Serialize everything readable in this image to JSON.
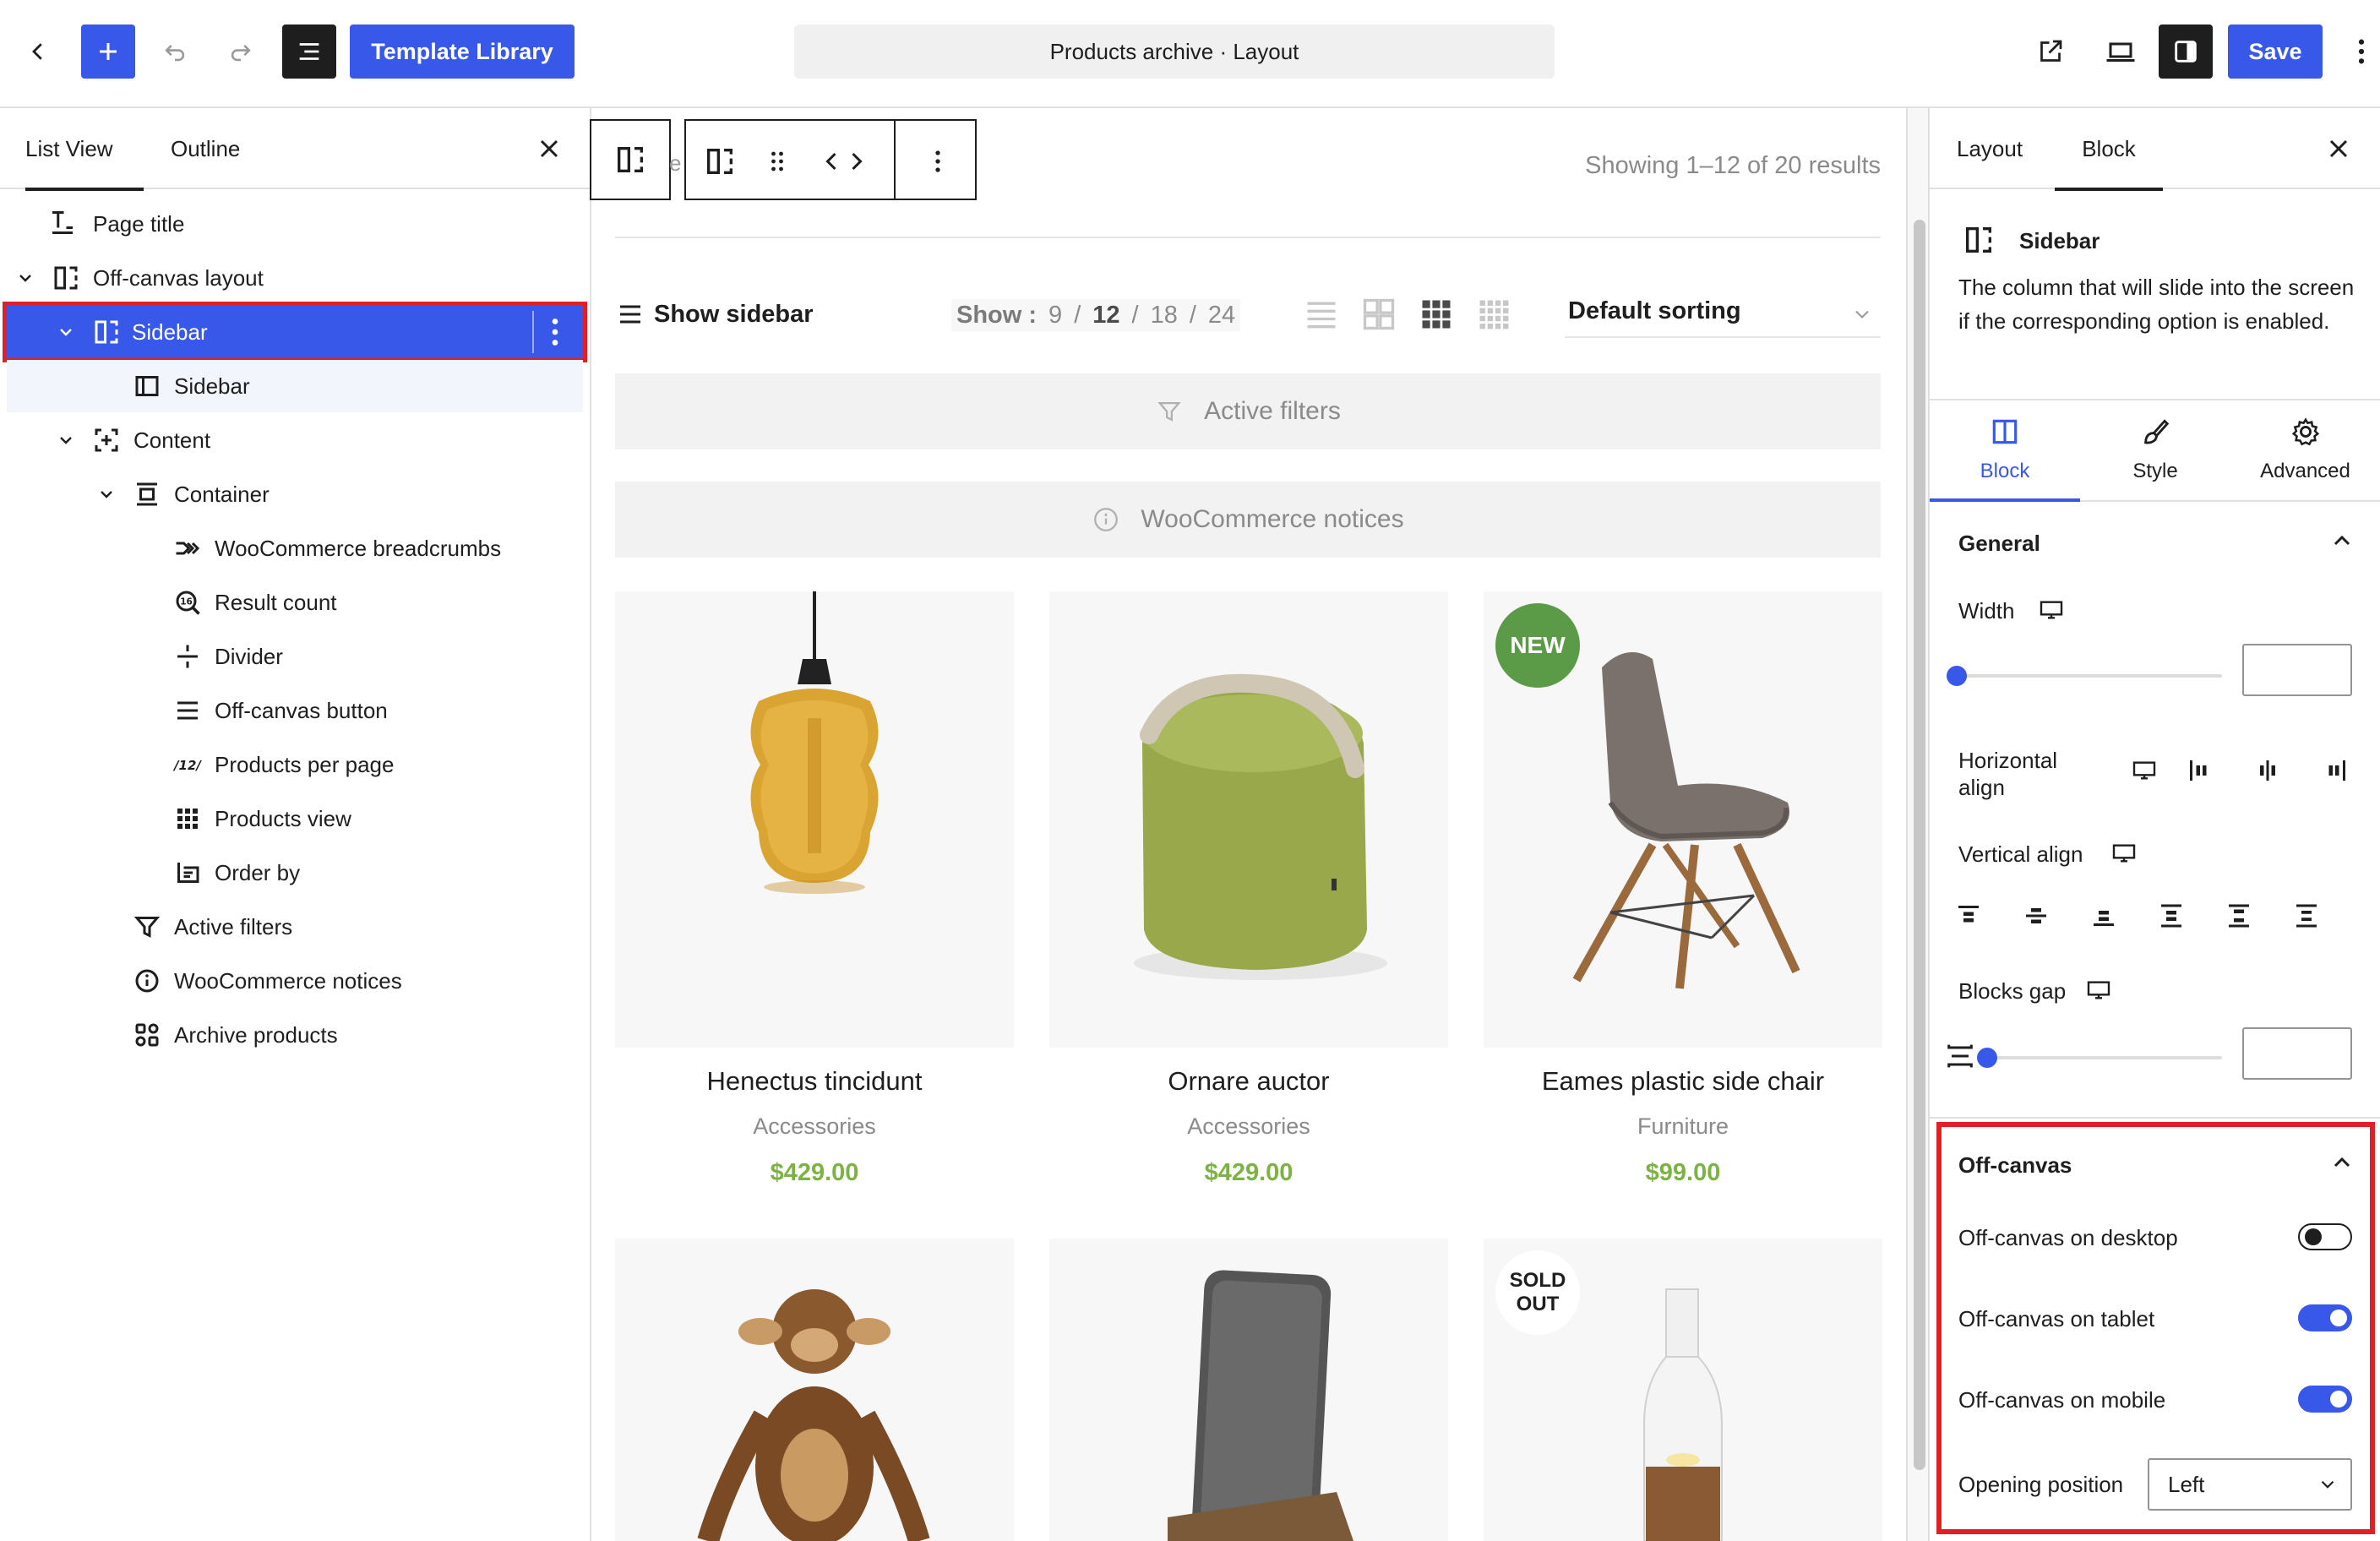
{
  "topbar": {
    "template_library_label": "Template Library",
    "document_title": "Products archive · Layout",
    "save_label": "Save"
  },
  "left_panel": {
    "tabs": [
      {
        "label": "List View",
        "active": true
      },
      {
        "label": "Outline",
        "active": false
      }
    ],
    "tree": [
      {
        "label": "Page title",
        "icon": "page-title-icon"
      },
      {
        "label": "Off-canvas layout",
        "icon": "off-canvas-layout-icon"
      },
      {
        "label": "Sidebar",
        "icon": "sidebar-column-icon",
        "selected": true
      },
      {
        "label": "Sidebar",
        "icon": "sidebar-panel-icon"
      },
      {
        "label": "Content",
        "icon": "content-icon"
      },
      {
        "label": "Container",
        "icon": "container-icon"
      },
      {
        "label": "WooCommerce breadcrumbs",
        "icon": "breadcrumbs-icon"
      },
      {
        "label": "Result count",
        "icon": "result-count-icon"
      },
      {
        "label": "Divider",
        "icon": "divider-icon"
      },
      {
        "label": "Off-canvas button",
        "icon": "menu-icon"
      },
      {
        "label": "Products per page",
        "icon": "products-per-page-icon"
      },
      {
        "label": "Products view",
        "icon": "grid-icon"
      },
      {
        "label": "Order by",
        "icon": "order-by-icon"
      },
      {
        "label": "Active filters",
        "icon": "filter-icon"
      },
      {
        "label": "WooCommerce notices",
        "icon": "info-icon"
      },
      {
        "label": "Archive products",
        "icon": "archive-products-icon"
      }
    ]
  },
  "canvas": {
    "toolbar_partial_text": "e",
    "result_count": "Showing 1–12 of 20 results",
    "show_sidebar_label": "Show sidebar",
    "per_page": {
      "label": "Show :",
      "options": [
        "9",
        "12",
        "18",
        "24"
      ],
      "separator": "/",
      "selected": "12"
    },
    "sorting": "Default sorting",
    "active_filters": "Active filters",
    "woocommerce_notices": "WooCommerce notices",
    "products": [
      {
        "title": "Henectus tincidunt",
        "category": "Accessories",
        "price": "$429.00"
      },
      {
        "title": "Ornare auctor",
        "category": "Accessories",
        "price": "$429.00"
      },
      {
        "title": "Eames plastic side chair",
        "category": "Furniture",
        "price": "$99.00",
        "badge": "NEW"
      }
    ],
    "row2_badge": {
      "line1": "SOLD",
      "line2": "OUT"
    },
    "colors": {
      "accent": "#3858e9",
      "price": "#7cb342",
      "new_badge": "#5b9a46",
      "highlight": "#e11f26"
    }
  },
  "right_panel": {
    "tabs": [
      {
        "label": "Layout",
        "active": false
      },
      {
        "label": "Block",
        "active": true
      }
    ],
    "block_name": "Sidebar",
    "block_description": "The column that will slide into the screen if the corresponding option is enabled.",
    "sub_tabs": [
      {
        "label": "Block",
        "active": true
      },
      {
        "label": "Style",
        "active": false
      },
      {
        "label": "Advanced",
        "active": false
      }
    ],
    "general": {
      "title": "General",
      "width_label": "Width",
      "width_value": "",
      "horizontal_align_label": "Horizontal align",
      "vertical_align_label": "Vertical align",
      "blocks_gap_label": "Blocks gap",
      "blocks_gap_value": ""
    },
    "offcanvas": {
      "title": "Off-canvas",
      "desktop_label": "Off-canvas on desktop",
      "desktop_on": false,
      "tablet_label": "Off-canvas on tablet",
      "tablet_on": true,
      "mobile_label": "Off-canvas on mobile",
      "mobile_on": true,
      "opening_position_label": "Opening position",
      "opening_position_value": "Left"
    }
  }
}
